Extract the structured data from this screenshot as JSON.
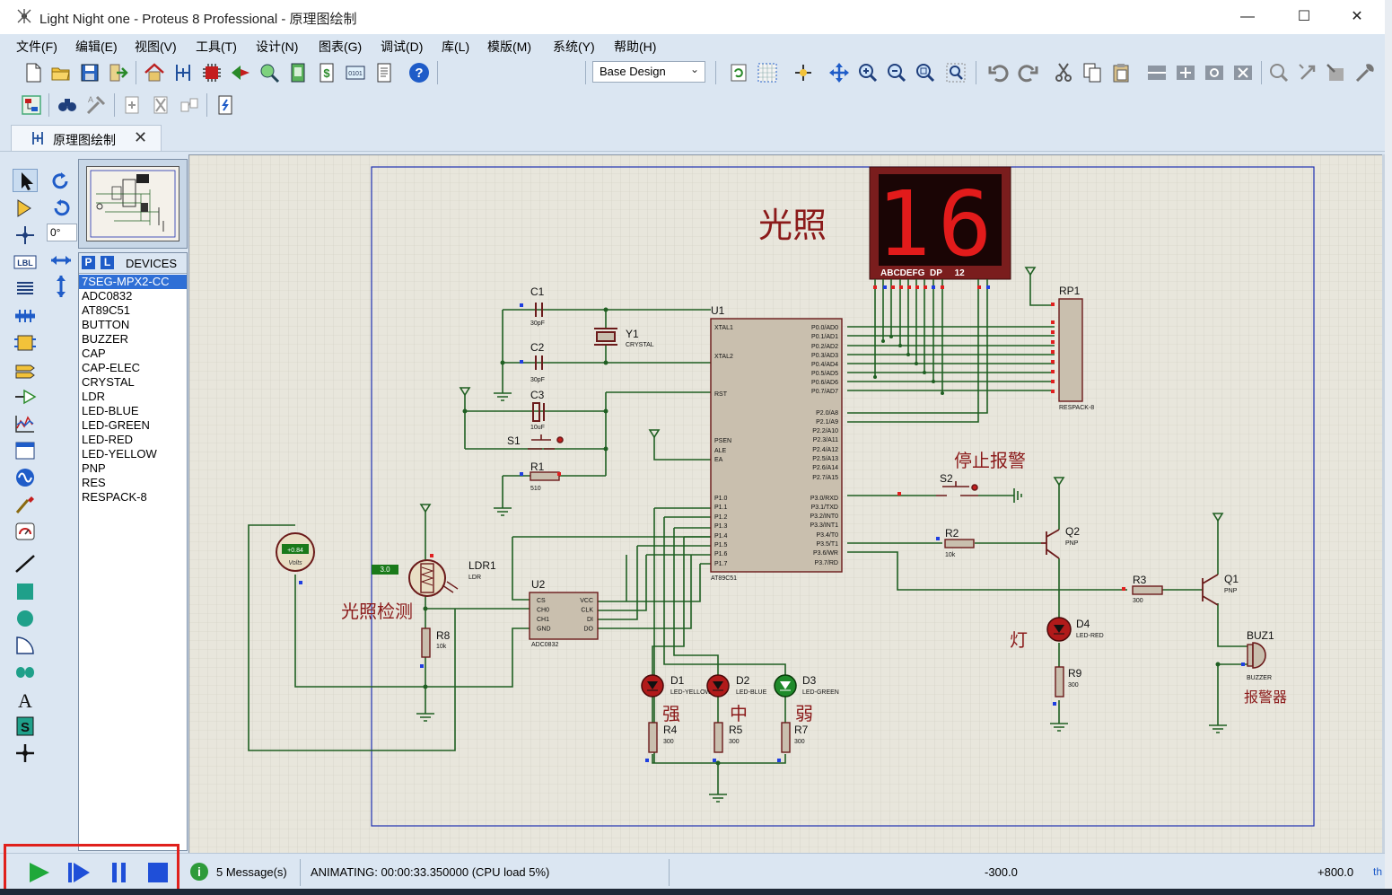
{
  "window": {
    "title": "Light Night one - Proteus 8 Professional - 原理图绘制",
    "minimize": "—",
    "maximize": "☐",
    "close": "✕"
  },
  "menu": [
    "文件(F)",
    "编辑(E)",
    "视图(V)",
    "工具(T)",
    "设计(N)",
    "图表(G)",
    "调试(D)",
    "库(L)",
    "模版(M)",
    "系统(Y)",
    "帮助(H)"
  ],
  "toolbar": {
    "design_select": "Base Design",
    "design_chevron": "⌄"
  },
  "tab": {
    "label": "原理图绘制",
    "close": "✕"
  },
  "rotation": {
    "angle": "0°"
  },
  "device_panel": {
    "p_btn": "P",
    "l_btn": "L",
    "title": "DEVICES",
    "items": [
      "7SEG-MPX2-CC",
      "ADC0832",
      "AT89C51",
      "BUTTON",
      "BUZZER",
      "CAP",
      "CAP-ELEC",
      "CRYSTAL",
      "LDR",
      "LED-BLUE",
      "LED-GREEN",
      "LED-RED",
      "LED-YELLOW",
      "PNP",
      "RES",
      "RESPACK-8"
    ],
    "selected_index": 0
  },
  "schematic": {
    "display_value": "16",
    "display_pins": "ABCDEFG  DP     12",
    "title_light": "光照",
    "label_detect": "光照检测",
    "label_stop_alarm": "停止报警",
    "label_lamp": "灯",
    "label_strong": "强",
    "label_mid": "中",
    "label_weak": "弱",
    "label_alarm": "报警器",
    "voltmeter_value": "+0.84",
    "voltmeter_unit": "Volts",
    "ldr_value": "3.0",
    "components": {
      "C1": "C1",
      "C1v": "30pF",
      "C2": "C2",
      "C2v": "30pF",
      "C3": "C3",
      "C3v": "10uF",
      "Y1": "Y1",
      "Y1v": "CRYSTAL",
      "S1": "S1",
      "S2": "S2",
      "R1": "R1",
      "R1v": "510",
      "U1": "U1",
      "U1v": "AT89C51",
      "RP1": "RP1",
      "RP1v": "RESPACK-8",
      "LDR1": "LDR1",
      "LDR1v": "LDR",
      "U2": "U2",
      "U2v": "ADC0832",
      "R8": "R8",
      "R8v": "10k",
      "R2": "R2",
      "R2v": "10k",
      "R3": "R3",
      "R3v": "300",
      "Q1": "Q1",
      "Q1v": "PNP",
      "Q2": "Q2",
      "Q2v": "PNP",
      "D1": "D1",
      "D1v": "LED-YELLOW",
      "D2": "D2",
      "D2v": "LED-BLUE",
      "D3": "D3",
      "D3v": "LED-GREEN",
      "D4": "D4",
      "D4v": "LED-RED",
      "R4": "R4",
      "R4v": "300",
      "R5": "R5",
      "R5v": "300",
      "R7": "R7",
      "R7v": "300",
      "R9": "R9",
      "R9v": "300",
      "BUZ1": "BUZ1",
      "BUZ1v": "BUZZER"
    },
    "u1_pins_left": [
      "XTAL1",
      "XTAL2",
      "RST",
      "PSEN",
      "ALE",
      "EA",
      "P1.0",
      "P1.1",
      "P1.2",
      "P1.3",
      "P1.4",
      "P1.5",
      "P1.6",
      "P1.7"
    ],
    "u1_pins_right": [
      "P0.0/AD0",
      "P0.1/AD1",
      "P0.2/AD2",
      "P0.3/AD3",
      "P0.4/AD4",
      "P0.5/AD5",
      "P0.6/AD6",
      "P0.7/AD7",
      "P2.0/A8",
      "P2.1/A9",
      "P2.2/A10",
      "P2.3/A11",
      "P2.4/A12",
      "P2.5/A13",
      "P2.6/A14",
      "P2.7/A15",
      "P3.0/RXD",
      "P3.1/TXD",
      "P3.2/INT0",
      "P3.3/INT1",
      "P3.4/T0",
      "P3.5/T1",
      "P3.6/WR",
      "P3.7/RD"
    ],
    "u2_pins_left": [
      "CS",
      "CH0",
      "CH1",
      "GND"
    ],
    "u2_pins_right": [
      "VCC",
      "CLK",
      "DI",
      "DO"
    ]
  },
  "status": {
    "messages": "5 Message(s)",
    "info_icon": "i",
    "animating": "ANIMATING: 00:00:33.350000 (CPU load 5%)",
    "coord_x": "-300.0",
    "coord_y": "+800.0",
    "th": "th"
  },
  "colors": {
    "wire": "#1f5f22",
    "component": "#7a1515",
    "label": "#8b1a1a",
    "sheet_border": "#1e2fb0",
    "highlight": "#e0201c",
    "accent": "#2f6fd6"
  }
}
